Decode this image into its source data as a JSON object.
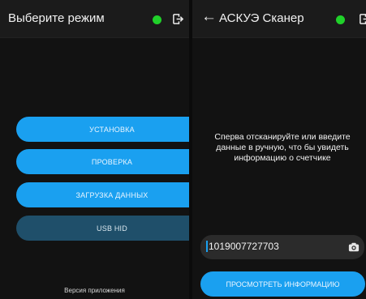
{
  "left": {
    "title": "Выберите режим",
    "buttons": [
      {
        "label": "УСТАНОВКА"
      },
      {
        "label": "ПРОВЕРКА"
      },
      {
        "label": "ЗАГРУЗКА ДАННЫХ"
      },
      {
        "label": "USB HID"
      }
    ],
    "version_label": "Версия приложения"
  },
  "right": {
    "title": "АСКУЭ Сканер",
    "hint": "Сперва отсканируйте или введите данные в ручную, что бы увидеть информацию о счетчике",
    "input_value": "1019007727703",
    "action_label": "ПРОСМОТРЕТЬ ИНФОРМАЦИЮ"
  },
  "colors": {
    "accent": "#1aa0f0",
    "status_online": "#20d12a",
    "dim_button": "#1f4f6a",
    "background": "#121212"
  },
  "icons": [
    "status-dot-icon",
    "exit-icon",
    "back-arrow-icon",
    "camera-icon"
  ]
}
